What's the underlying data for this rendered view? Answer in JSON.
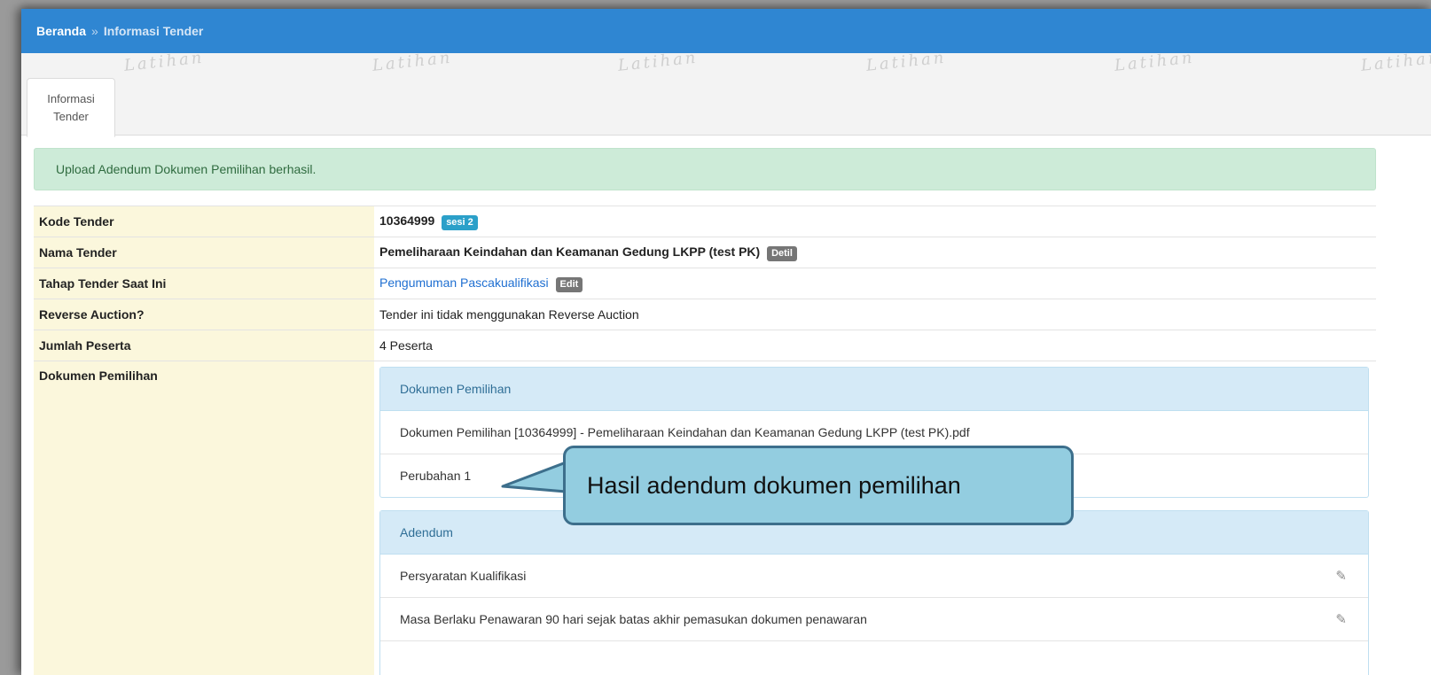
{
  "breadcrumb": {
    "home": "Beranda",
    "separator": "»",
    "current": "Informasi Tender"
  },
  "watermark_text": "Latihan",
  "tab": {
    "line1": "Informasi",
    "line2": "Tender"
  },
  "alert": {
    "message": "Upload Adendum Dokumen Pemilihan berhasil."
  },
  "info": {
    "kode_label": "Kode Tender",
    "kode_value": "10364999",
    "kode_badge": "sesi 2",
    "nama_label": "Nama Tender",
    "nama_value": "Pemeliharaan Keindahan dan Keamanan Gedung LKPP (test PK)",
    "nama_badge": "Detil",
    "tahap_label": "Tahap Tender Saat Ini",
    "tahap_value": "Pengumuman Pascakualifikasi",
    "tahap_badge": "Edit",
    "reverse_label": "Reverse Auction?",
    "reverse_value": "Tender ini tidak menggunakan Reverse Auction",
    "peserta_label": "Jumlah Peserta",
    "peserta_value": "4 Peserta",
    "dokumen_label": "Dokumen Pemilihan"
  },
  "dokumen_panel": {
    "title": "Dokumen Pemilihan",
    "rows": [
      "Dokumen Pemilihan [10364999] - Pemeliharaan Keindahan dan Keamanan Gedung LKPP (test PK).pdf",
      "Perubahan 1"
    ]
  },
  "adendum_panel": {
    "title": "Adendum",
    "rows": [
      "Persyaratan Kualifikasi",
      "Masa Berlaku Penawaran 90 hari sejak batas akhir pemasukan dokumen penawaran"
    ]
  },
  "callout": {
    "text": "Hasil adendum dokumen pemilihan"
  },
  "colors": {
    "topbar": "#2f86d2",
    "alert_bg": "#cdebd8",
    "label_bg": "#fbf7dc",
    "panel_head": "#d5eaf7",
    "callout_bg": "#93cde0",
    "link": "#1f6fd1"
  },
  "icons": {
    "edit": "edit-pencil-icon"
  }
}
